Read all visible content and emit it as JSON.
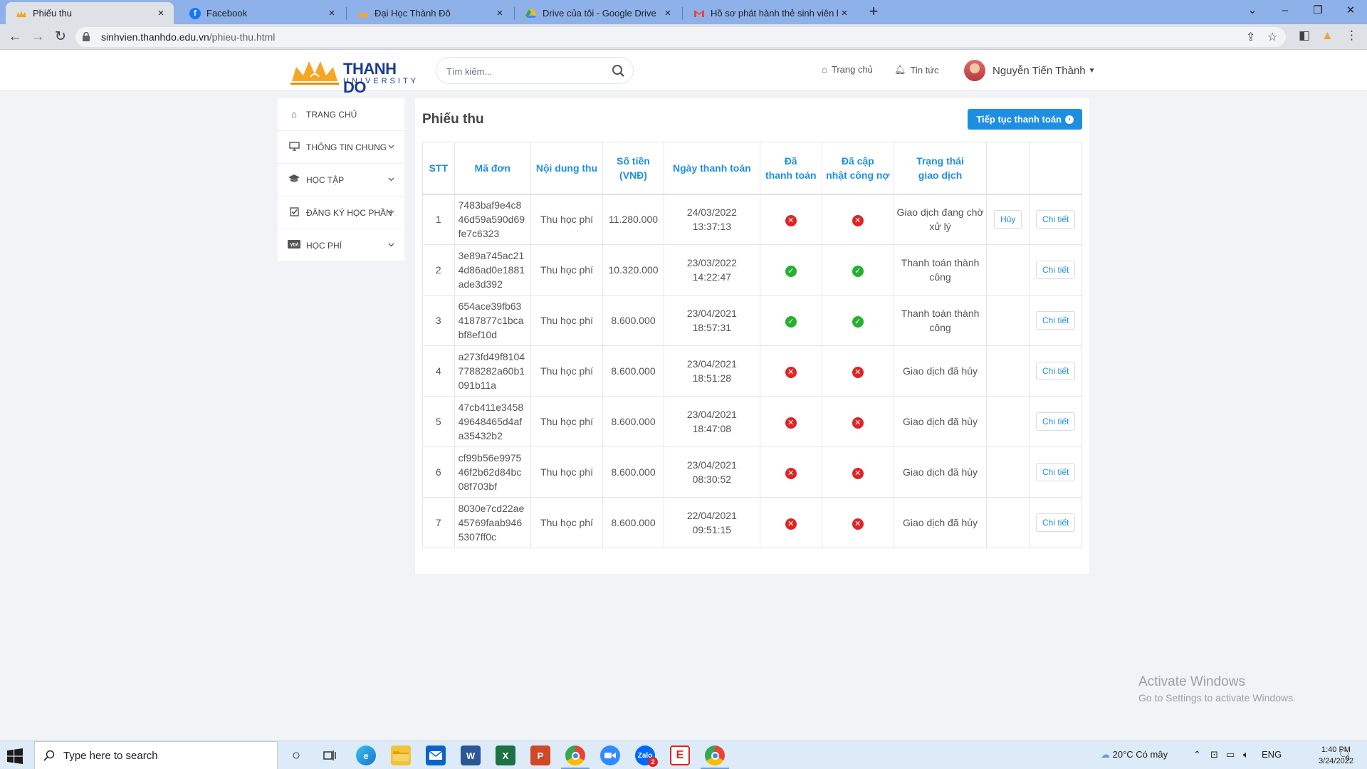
{
  "browser": {
    "tabs": [
      {
        "title": "Phiếu thu",
        "active": true
      },
      {
        "title": "Facebook",
        "active": false
      },
      {
        "title": "Đại Học Thành Đô",
        "active": false
      },
      {
        "title": "Drive của tôi - Google Drive",
        "active": false
      },
      {
        "title": "Hồ sơ phát hành thẻ sinh viên liê",
        "active": false
      }
    ],
    "url_host": "sinhvien.thanhdo.edu.vn",
    "url_path": "/phieu-thu.html"
  },
  "header": {
    "logo_brand": "THANH DO",
    "logo_sub": "UNIVERSITY",
    "search_placeholder": "Tìm kiếm...",
    "nav_home": "Trang chủ",
    "nav_news": "Tin tức",
    "user_name": "Nguyễn Tiến Thành"
  },
  "sidebar": {
    "items": [
      {
        "label": "TRANG CHỦ",
        "icon": "home-icon",
        "has_chevron": false
      },
      {
        "label": "THÔNG TIN CHUNG",
        "icon": "monitor-icon",
        "has_chevron": true
      },
      {
        "label": "HỌC TẬP",
        "icon": "graduation-cap-icon",
        "has_chevron": true
      },
      {
        "label": "ĐĂNG KÝ HỌC PHẦN",
        "icon": "checkbox-icon",
        "has_chevron": true
      },
      {
        "label": "HỌC PHÍ",
        "icon": "visa-card-icon",
        "has_chevron": true
      }
    ]
  },
  "main": {
    "title": "Phiếu thu",
    "continue_button": "Tiếp tục thanh toán",
    "columns": {
      "stt": "STT",
      "code": "Mã đơn",
      "content": "Nội dung thu",
      "amount_1": "Số tiền",
      "amount_2": "(VNĐ)",
      "date": "Ngày thanh toán",
      "paid_1": "Đã",
      "paid_2": "thanh toán",
      "debt_1": "Đã cập",
      "debt_2": "nhật công nợ",
      "status_1": "Trạng thái",
      "status_2": "giao dịch"
    },
    "rows": [
      {
        "stt": "1",
        "code": "7483baf9e4c846d59a590d69fe7c6323",
        "content": "Thu học phí",
        "amount": "11.280.000",
        "date": "24/03/2022",
        "time": "13:37:13",
        "paid": false,
        "debt_updated": false,
        "status": "Giao dịch đang chờ xử lý",
        "cancel_label": "Hủy",
        "detail_label": "Chi tiết"
      },
      {
        "stt": "2",
        "code": "3e89a745ac214d86ad0e1881ade3d392",
        "content": "Thu học phí",
        "amount": "10.320.000",
        "date": "23/03/2022",
        "time": "14:22:47",
        "paid": true,
        "debt_updated": true,
        "status": "Thanh toán thành công",
        "cancel_label": "",
        "detail_label": "Chi tiết"
      },
      {
        "stt": "3",
        "code": "654ace39fb634187877c1bcabf8ef10d",
        "content": "Thu học phí",
        "amount": "8.600.000",
        "date": "23/04/2021",
        "time": "18:57:31",
        "paid": true,
        "debt_updated": true,
        "status": "Thanh toán thành công",
        "cancel_label": "",
        "detail_label": "Chi tiết"
      },
      {
        "stt": "4",
        "code": "a273fd49f81047788282a60b1091b11a",
        "content": "Thu học phí",
        "amount": "8.600.000",
        "date": "23/04/2021",
        "time": "18:51:28",
        "paid": false,
        "debt_updated": false,
        "status": "Giao dịch đã hủy",
        "cancel_label": "",
        "detail_label": "Chi tiết"
      },
      {
        "stt": "5",
        "code": "47cb411e345849648465d4afa35432b2",
        "content": "Thu học phí",
        "amount": "8.600.000",
        "date": "23/04/2021",
        "time": "18:47:08",
        "paid": false,
        "debt_updated": false,
        "status": "Giao dịch đã hủy",
        "cancel_label": "",
        "detail_label": "Chi tiết"
      },
      {
        "stt": "6",
        "code": "cf99b56e997546f2b62d84bc08f703bf",
        "content": "Thu học phí",
        "amount": "8.600.000",
        "date": "23/04/2021",
        "time": "08:30:52",
        "paid": false,
        "debt_updated": false,
        "status": "Giao dịch đã hủy",
        "cancel_label": "",
        "detail_label": "Chi tiết"
      },
      {
        "stt": "7",
        "code": "8030e7cd22ae45769faab9465307ff0c",
        "content": "Thu học phí",
        "amount": "8.600.000",
        "date": "22/04/2021",
        "time": "09:51:15",
        "paid": false,
        "debt_updated": false,
        "status": "Giao dịch đã hủy",
        "cancel_label": "",
        "detail_label": "Chi tiết"
      }
    ]
  },
  "watermark": {
    "line1": "Activate Windows",
    "line2": "Go to Settings to activate Windows."
  },
  "taskbar": {
    "search_placeholder": "Type here to search",
    "weather": "20°C  Có mây",
    "lang": "ENG",
    "time": "1:40 PM",
    "date": "3/24/2022",
    "notif_count": "3",
    "zalo_badge": "2"
  },
  "colors": {
    "accent": "#1e8fe0",
    "success": "#25b12f",
    "danger": "#e02424",
    "tabbar": "#8eb1ea"
  }
}
